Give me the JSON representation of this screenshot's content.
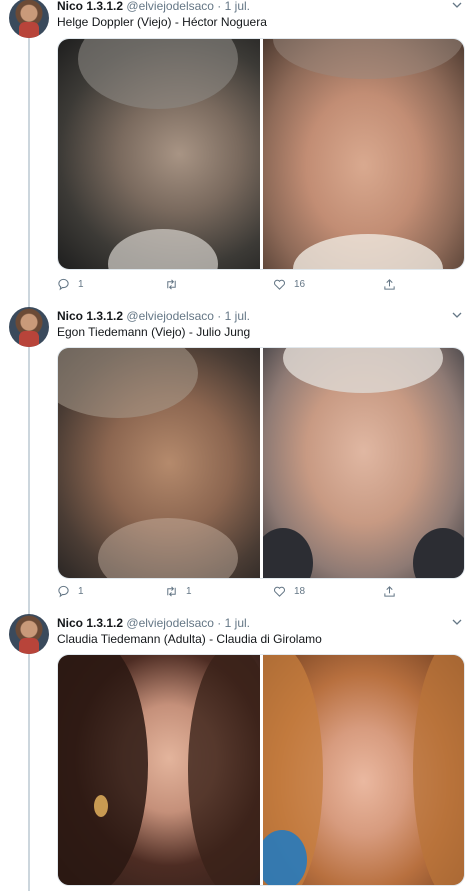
{
  "tweets": [
    {
      "author": "Nico 1.3.1.2",
      "handle": "@elviejodelsaco",
      "separator": "·",
      "date": "1 jul.",
      "text": "Helge Doppler (Viejo) - Héctor Noguera",
      "replies": "1",
      "retweets": "",
      "likes": "16"
    },
    {
      "author": "Nico 1.3.1.2",
      "handle": "@elviejodelsaco",
      "separator": "·",
      "date": "1 jul.",
      "text": "Egon Tiedemann (Viejo) - Julio Jung",
      "replies": "1",
      "retweets": "1",
      "likes": "18"
    },
    {
      "author": "Nico 1.3.1.2",
      "handle": "@elviejodelsaco",
      "separator": "·",
      "date": "1 jul.",
      "text": "Claudia Tiedemann (Adulta) - Claudia di Girolamo"
    }
  ],
  "icons": {
    "reply": "reply-icon",
    "retweet": "retweet-icon",
    "like": "heart-icon",
    "share": "share-icon",
    "caret": "chevron-down-icon"
  },
  "colors": {
    "text": "#14171a",
    "muted": "#657786",
    "thread_line": "#ccd6dd"
  }
}
